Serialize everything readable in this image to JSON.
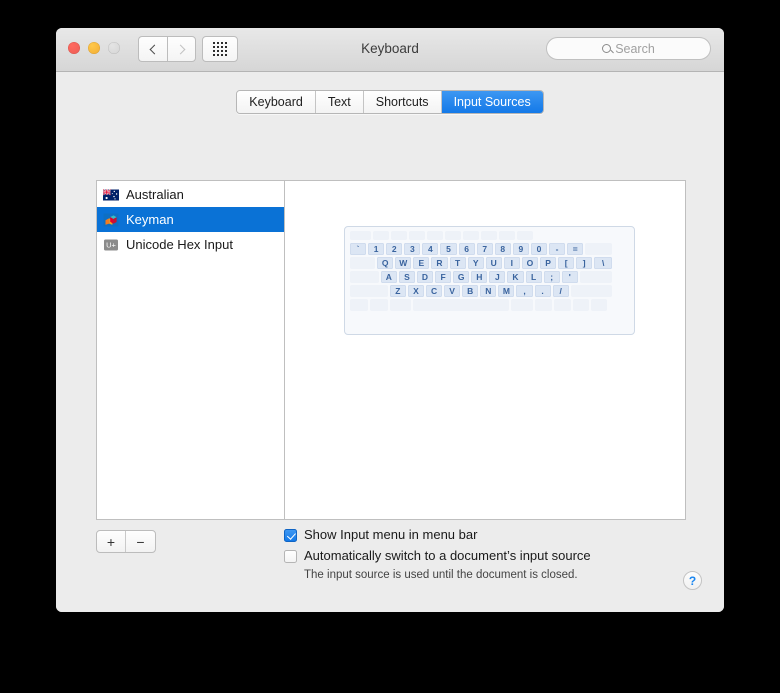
{
  "window": {
    "title": "Keyboard",
    "traffic_lights": [
      "close",
      "minimize",
      "zoom"
    ],
    "nav": {
      "back_icon": "chevron-left-icon",
      "forward_icon": "chevron-right-icon",
      "show_all_icon": "grid-dots-icon"
    },
    "search": {
      "placeholder": "Search",
      "value": "",
      "icon": "search-icon"
    }
  },
  "tabs": [
    {
      "label": "Keyboard",
      "active": false
    },
    {
      "label": "Text",
      "active": false
    },
    {
      "label": "Shortcuts",
      "active": false
    },
    {
      "label": "Input Sources",
      "active": true
    }
  ],
  "input_sources": [
    {
      "label": "Australian",
      "icon": "australian-flag-icon",
      "selected": false
    },
    {
      "label": "Keyman",
      "icon": "keyman-icon",
      "selected": true
    },
    {
      "label": "Unicode Hex Input",
      "icon": "unicode-hex-icon",
      "badge": "U+",
      "selected": false
    }
  ],
  "list_buttons": {
    "add_label": "+",
    "remove_label": "−"
  },
  "keyboard_preview": {
    "rows": [
      {
        "name": "function-row",
        "keys": [
          "",
          "",
          "",
          "",
          "",
          "",
          "",
          "",
          "",
          ""
        ],
        "widths": [
          1.25,
          1,
          1,
          1,
          1,
          1,
          1,
          1,
          1,
          1
        ]
      },
      {
        "name": "number-row",
        "keys": [
          "`",
          "1",
          "2",
          "3",
          "4",
          "5",
          "6",
          "7",
          "8",
          "9",
          "0",
          "-",
          "=",
          ""
        ],
        "widths": [
          1,
          1,
          1,
          1,
          1,
          1,
          1,
          1,
          1,
          1,
          1,
          1,
          1,
          1.6
        ]
      },
      {
        "name": "qwerty-row",
        "keys": [
          "",
          "Q",
          "W",
          "E",
          "R",
          "T",
          "Y",
          "U",
          "I",
          "O",
          "P",
          "[",
          "]",
          "\\"
        ],
        "widths": [
          1.5,
          1,
          1,
          1,
          1,
          1,
          1,
          1,
          1,
          1,
          1,
          1,
          1,
          1.1
        ]
      },
      {
        "name": "home-row",
        "keys": [
          "",
          "A",
          "S",
          "D",
          "F",
          "G",
          "H",
          "J",
          "K",
          "L",
          ";",
          "'",
          ""
        ],
        "widths": [
          1.7,
          1,
          1,
          1,
          1,
          1,
          1,
          1,
          1,
          1,
          1,
          1,
          1.9
        ]
      },
      {
        "name": "zxcv-row",
        "keys": [
          "",
          "Z",
          "X",
          "C",
          "V",
          "B",
          "N",
          "M",
          ",",
          ".",
          "/",
          ""
        ],
        "widths": [
          2.2,
          1,
          1,
          1,
          1,
          1,
          1,
          1,
          1,
          1,
          1,
          2.4
        ]
      },
      {
        "name": "modifier-row",
        "keys": [
          "",
          "",
          "",
          "",
          "",
          "",
          "",
          "",
          ""
        ],
        "widths": [
          1.1,
          1.1,
          1.3,
          5.4,
          1.3,
          1.1,
          1,
          1,
          1
        ]
      }
    ]
  },
  "options": [
    {
      "label": "Show Input menu in menu bar",
      "checked": true
    },
    {
      "label": "Automatically switch to a document’s input source",
      "checked": false
    }
  ],
  "hint": "The input source is used until the document is closed.",
  "help": {
    "label": "?"
  },
  "colors": {
    "accent": "#0a72d6",
    "tab_active": "#1379e8",
    "key_text": "#39639e",
    "window_bg": "#ececec"
  }
}
